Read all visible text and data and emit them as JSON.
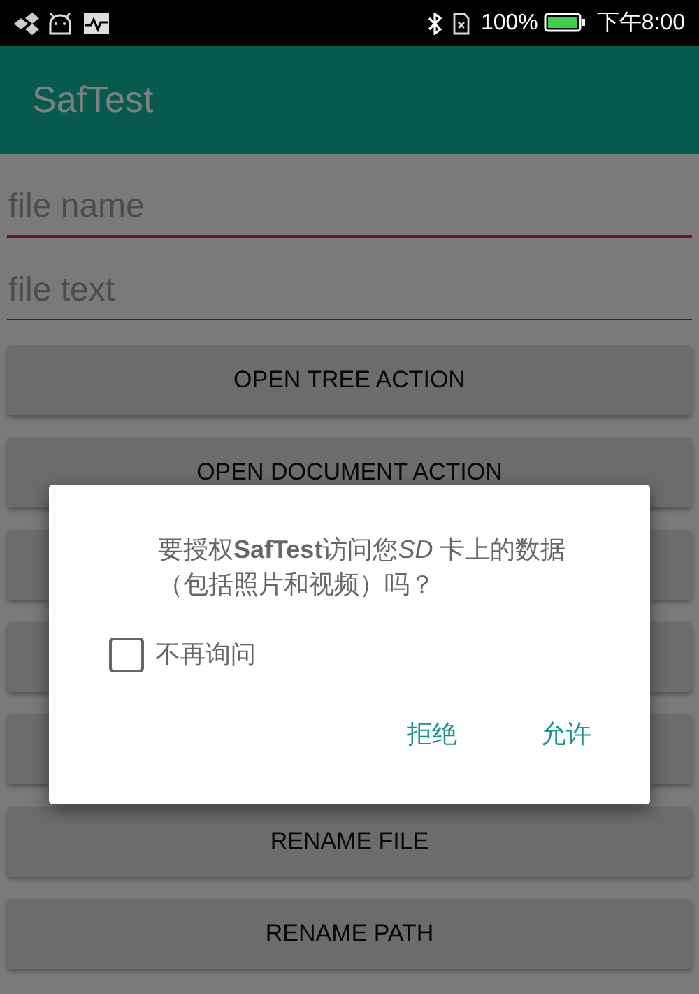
{
  "status_bar": {
    "battery_text": "100%",
    "time": "下午8:00"
  },
  "app_bar": {
    "title": "SafTest"
  },
  "fields": [
    {
      "placeholder": "file name",
      "focused": true
    },
    {
      "placeholder": "file text",
      "focused": false
    }
  ],
  "buttons": [
    {
      "kind": "labeled",
      "label": "OPEN TREE ACTION"
    },
    {
      "kind": "labeled",
      "label": "OPEN DOCUMENT ACTION"
    },
    {
      "kind": "covered"
    },
    {
      "kind": "covered"
    },
    {
      "kind": "covered"
    },
    {
      "kind": "labeled",
      "label": "RENAME FILE"
    },
    {
      "kind": "labeled",
      "label": "RENAME PATH"
    }
  ],
  "dialog": {
    "message": [
      {
        "text": "要授权",
        "kind": "normal"
      },
      {
        "text": "SafTest",
        "kind": "strong"
      },
      {
        "text": "访问您",
        "kind": "normal"
      },
      {
        "text": "SD",
        "kind": "emphasis"
      },
      {
        "text": " 卡上的数据（包括照片和视频）吗？",
        "kind": "normal"
      }
    ],
    "checkbox": {
      "label": "不再询问",
      "checked": false
    },
    "actions": [
      {
        "label": "拒绝"
      },
      {
        "label": "允许"
      }
    ]
  }
}
